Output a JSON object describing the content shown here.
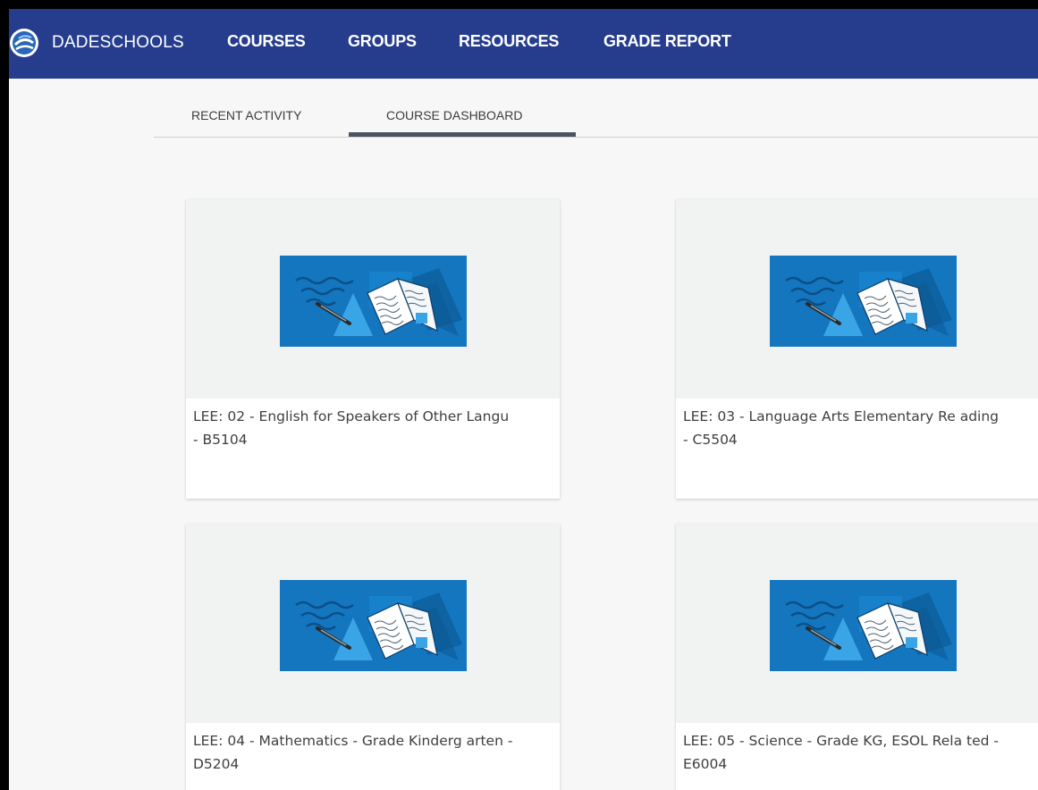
{
  "header": {
    "brand": "DADESCHOOLS",
    "logo_icon": "dadeschools-logo-icon",
    "nav": [
      {
        "label": "COURSES"
      },
      {
        "label": "GROUPS"
      },
      {
        "label": "RESOURCES"
      },
      {
        "label": "GRADE REPORT"
      }
    ]
  },
  "tabs": [
    {
      "label": "RECENT ACTIVITY",
      "active": false
    },
    {
      "label": "COURSE DASHBOARD",
      "active": true
    }
  ],
  "courses": [
    {
      "title": "LEE: 02 - English for Speakers of Other Langu - B5104",
      "image_icon": "course-book-illustration-icon"
    },
    {
      "title": "LEE: 03 - Language Arts Elementary Re ading - C5504",
      "image_icon": "course-book-illustration-icon"
    },
    {
      "title": "LEE: 04 - Mathematics - Grade Kinderg arten - D5204",
      "image_icon": "course-book-illustration-icon"
    },
    {
      "title": "LEE: 05 - Science - Grade KG, ESOL Rela ted - E6004",
      "image_icon": "course-book-illustration-icon"
    }
  ],
  "colors": {
    "nav_background": "#263d8e",
    "art_background": "#1476bf",
    "page_background": "#f7f7f7",
    "active_tab_underline": "#4a5460"
  }
}
